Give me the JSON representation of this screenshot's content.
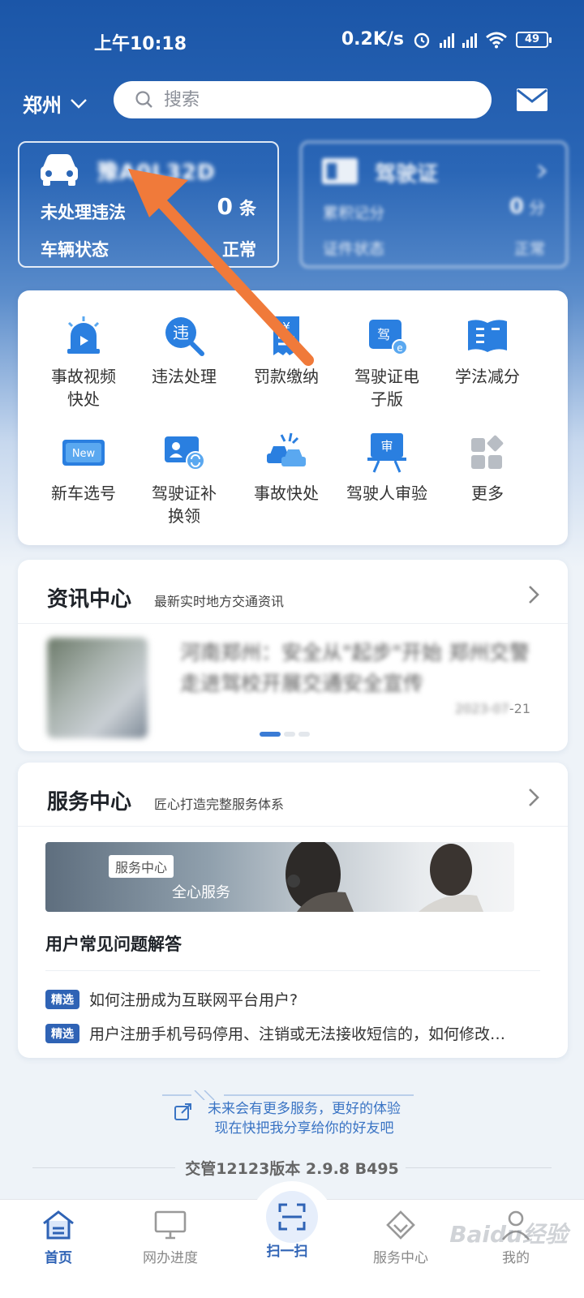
{
  "status": {
    "time": "上午10:18",
    "speed": "0.2K/s",
    "battery": "49"
  },
  "header": {
    "city": "郑州",
    "search_placeholder": "搜索"
  },
  "vehicle_card": {
    "plate": "豫A0L32D",
    "violation_label": "未处理违法",
    "violation_count": "0",
    "violation_unit": "条",
    "status_label": "车辆状态",
    "status_value": "正常"
  },
  "license_card": {
    "title": "驾驶证",
    "points_label": "累积记分",
    "points_value": "0",
    "points_unit": "分",
    "status_label": "证件状态",
    "status_value": "正常"
  },
  "services": [
    {
      "label": "事故视频\n快处",
      "icon": "siren-video-icon"
    },
    {
      "label": "违法处理",
      "icon": "violation-search-icon"
    },
    {
      "label": "罚款缴纳",
      "icon": "fine-receipt-icon"
    },
    {
      "label": "驾驶证电\n子版",
      "icon": "e-license-icon"
    },
    {
      "label": "学法减分",
      "icon": "book-icon"
    },
    {
      "label": "新车选号",
      "icon": "new-plate-icon"
    },
    {
      "label": "驾驶证补\n换领",
      "icon": "license-swap-icon"
    },
    {
      "label": "事故快处",
      "icon": "car-crash-icon"
    },
    {
      "label": "驾驶人审验",
      "icon": "review-board-icon"
    },
    {
      "label": "更多",
      "icon": "grid-more-icon"
    }
  ],
  "news": {
    "title": "资讯中心",
    "subtitle": "最新实时地方交通资讯",
    "headline": "河南郑州：安全从\"起步\"开始 郑州交警走进驾校开展交通安全宣传",
    "date_prefix": "2023-07",
    "date_suffix": "-21"
  },
  "service_center": {
    "title": "服务中心",
    "subtitle": "匠心打造完整服务体系",
    "banner_tag": "服务中心",
    "banner_text": "全心服务",
    "faq_title": "用户常见问题解答",
    "faq": [
      {
        "tag": "精选",
        "text": "如何注册成为互联网平台用户?"
      },
      {
        "tag": "精选",
        "text": "用户注册手机号码停用、注销或无法接收短信的，如何修改…"
      }
    ]
  },
  "share": {
    "line1": "未来会有更多服务，更好的体验",
    "line2": "现在快把我分享给你的好友吧"
  },
  "version": "交管12123版本 2.9.8 B495",
  "tabs": [
    {
      "label": "首页",
      "icon": "home-icon"
    },
    {
      "label": "网办进度",
      "icon": "monitor-icon"
    },
    {
      "label": "扫一扫",
      "icon": "scan-icon"
    },
    {
      "label": "服务中心",
      "icon": "service-icon"
    },
    {
      "label": "我的",
      "icon": "user-icon"
    }
  ],
  "watermark": "Baidu经验",
  "colors": {
    "brand_blue": "#1b56a8",
    "accent_blue": "#2f63b5",
    "arrow_orange": "#f07a3a"
  }
}
